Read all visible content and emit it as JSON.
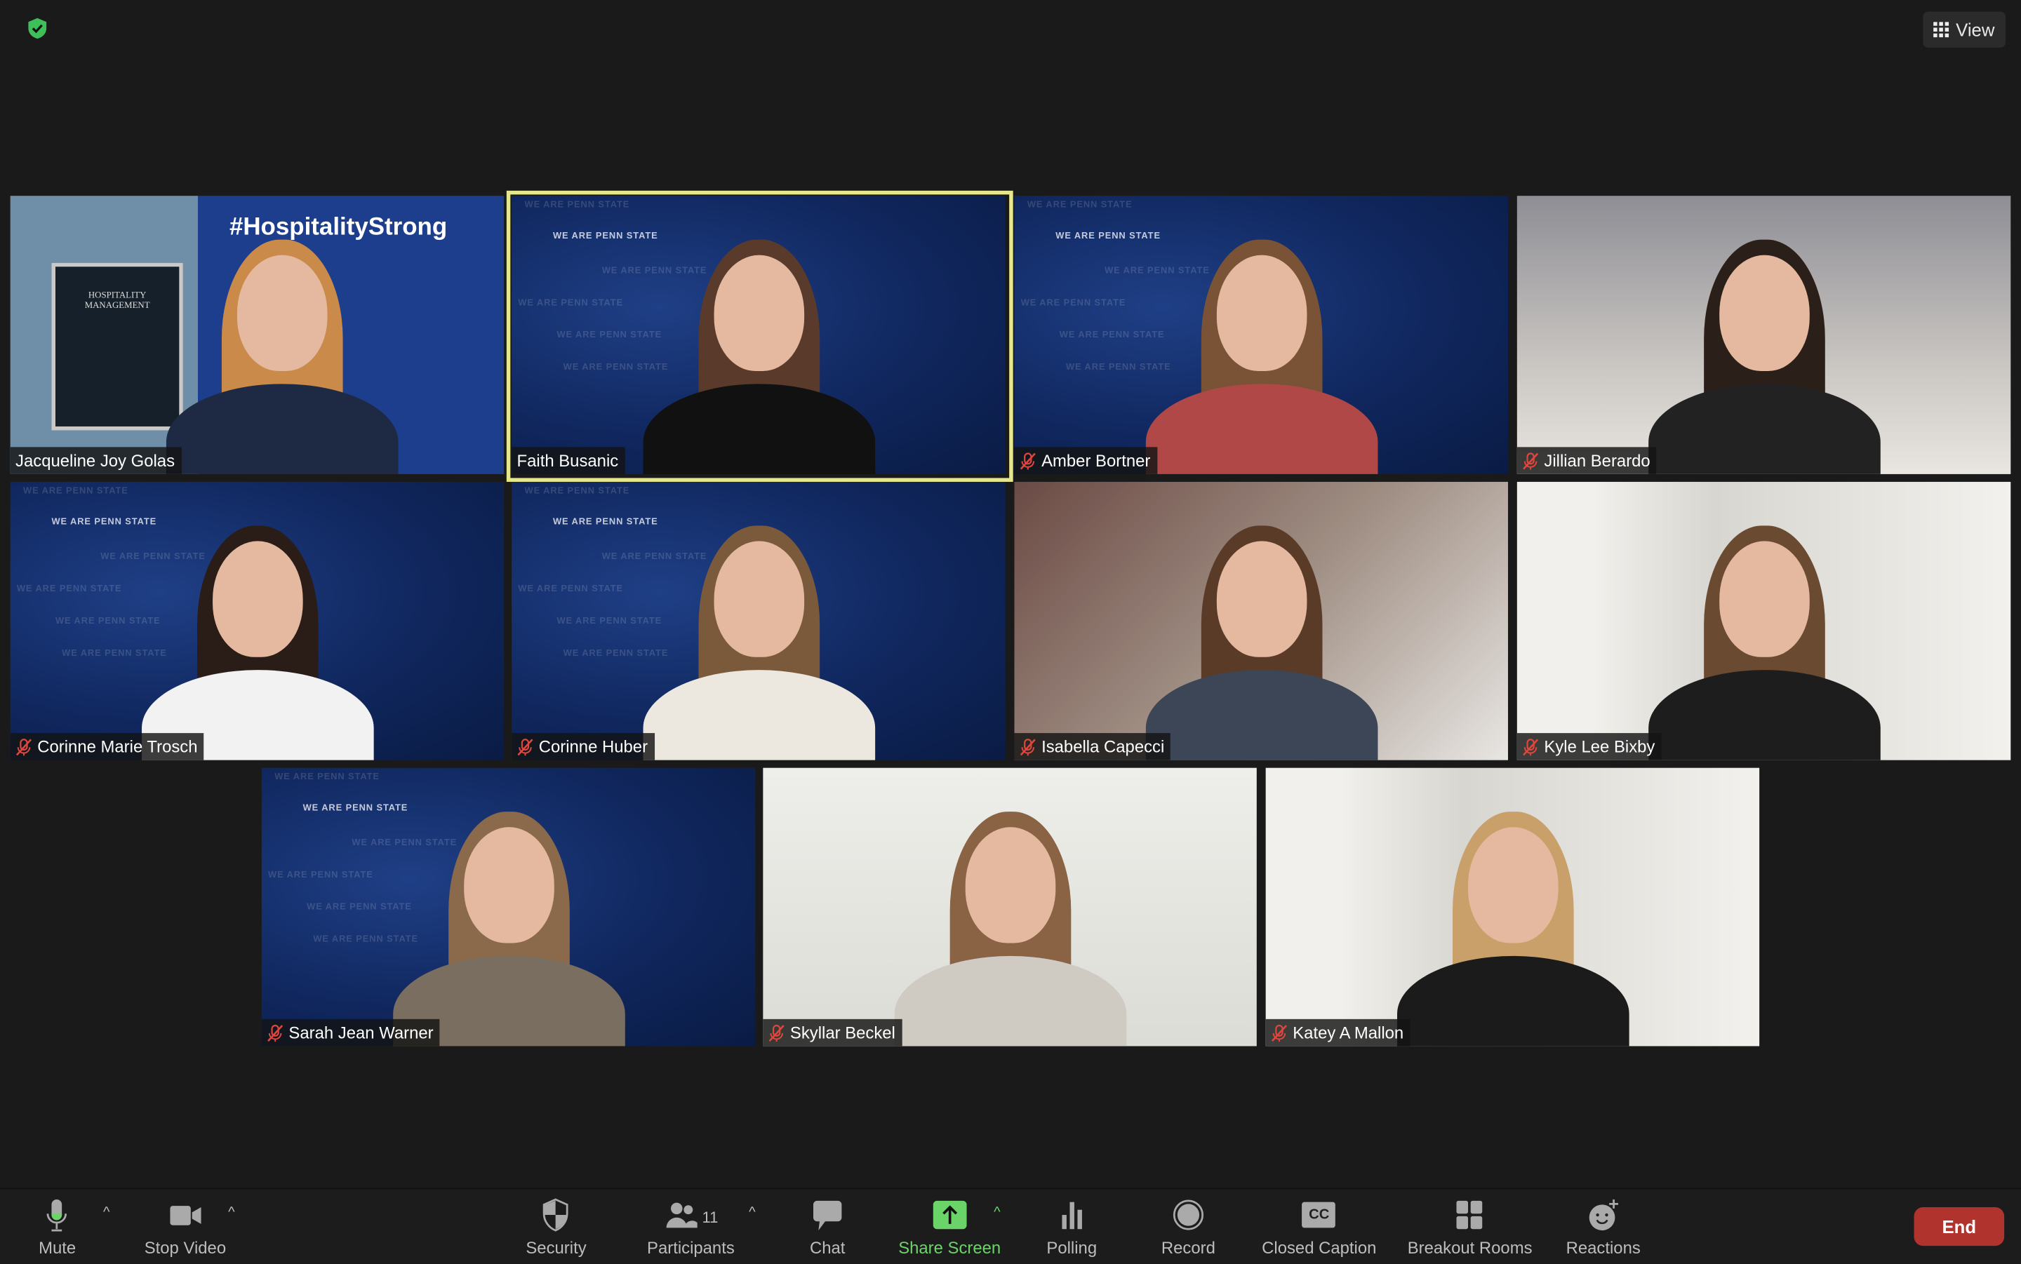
{
  "top": {
    "view_label": "View",
    "security_status_icon": "shield-check-icon"
  },
  "colors": {
    "accent_green": "#6bd469",
    "active_speaker": "#e6e88e",
    "end_red": "#b1332e"
  },
  "host_tile": {
    "hashtag": "#HospitalityStrong",
    "sign_title": "HOSPITALITY MANAGEMENT"
  },
  "watermark": "WE ARE PENN STATE",
  "participants": [
    {
      "name": "Jacqueline Joy Golas",
      "muted": false
    },
    {
      "name": "Faith Busanic",
      "muted": false,
      "active_speaker": true
    },
    {
      "name": "Amber Bortner",
      "muted": true
    },
    {
      "name": "Jillian Berardo",
      "muted": true
    },
    {
      "name": "Corinne Marie Trosch",
      "muted": true
    },
    {
      "name": "Corinne Huber",
      "muted": true
    },
    {
      "name": "Isabella Capecci",
      "muted": true
    },
    {
      "name": "Kyle Lee Bixby",
      "muted": true
    },
    {
      "name": "Sarah Jean Warner",
      "muted": true
    },
    {
      "name": "Skyllar Beckel",
      "muted": true
    },
    {
      "name": "Katey A Mallon",
      "muted": true
    }
  ],
  "toolbar": {
    "mute": "Mute",
    "stop_video": "Stop Video",
    "security": "Security",
    "participants": "Participants",
    "participant_count": "11",
    "chat": "Chat",
    "share_screen": "Share Screen",
    "polling": "Polling",
    "record": "Record",
    "closed_caption": "Closed Caption",
    "cc_glyph": "CC",
    "breakout_rooms": "Breakout Rooms",
    "reactions": "Reactions",
    "end": "End"
  }
}
